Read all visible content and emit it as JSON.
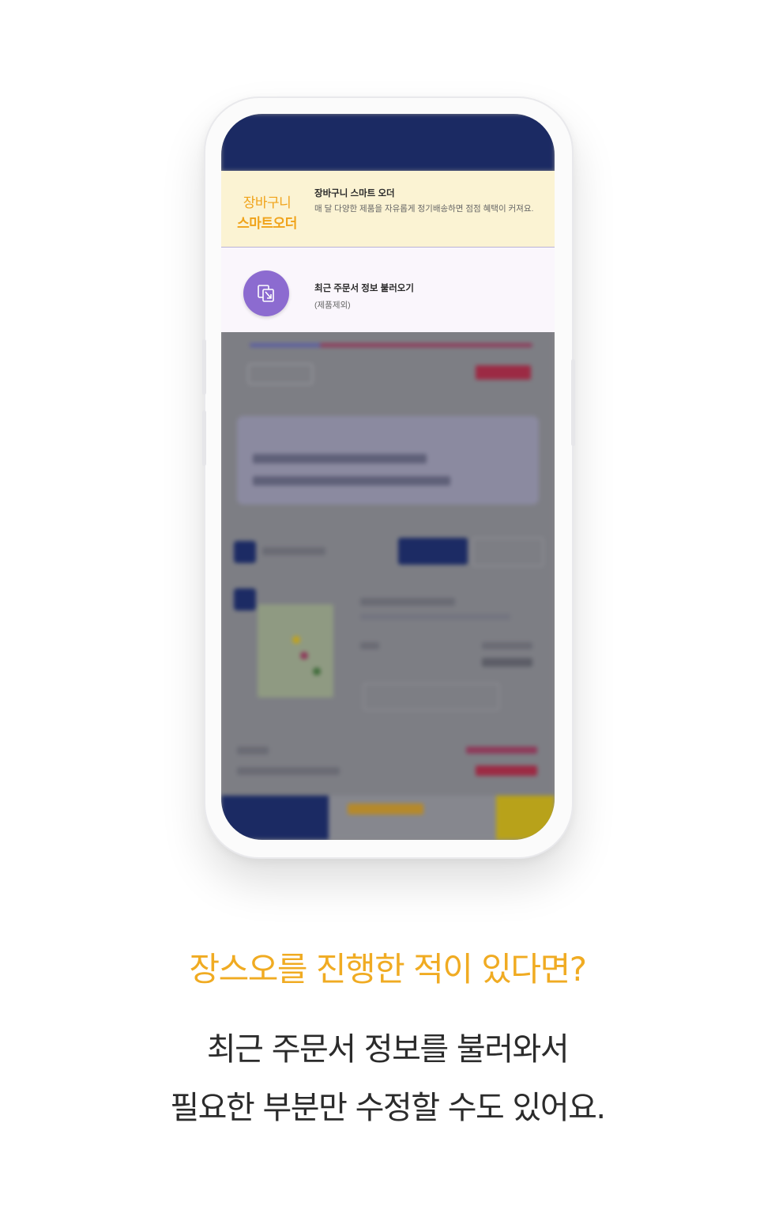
{
  "colors": {
    "accent": "#f0ab22",
    "navy": "#1b2a63",
    "purple_icon": "#8c6bd0",
    "smart_order_bg": "#fbf3d3"
  },
  "popup": {
    "smart_order": {
      "logo_line1": "장바구니",
      "logo_line2": "스마트오더",
      "title": "장바구니 스마트 오더",
      "description": "매 달 다양한 제품을 자유롭게 정기배송하면 점점 혜택이 커져요."
    },
    "recent_order": {
      "icon": "import-document-icon",
      "title": "최근 주문서 정보 불러오기",
      "subtitle": "(제품제외)"
    }
  },
  "caption": {
    "headline": "장스오를 진행한 적이 있다면?",
    "line1": "최근 주문서 정보를 불러와서",
    "line2": "필요한 부분만 수정할 수도 있어요."
  }
}
